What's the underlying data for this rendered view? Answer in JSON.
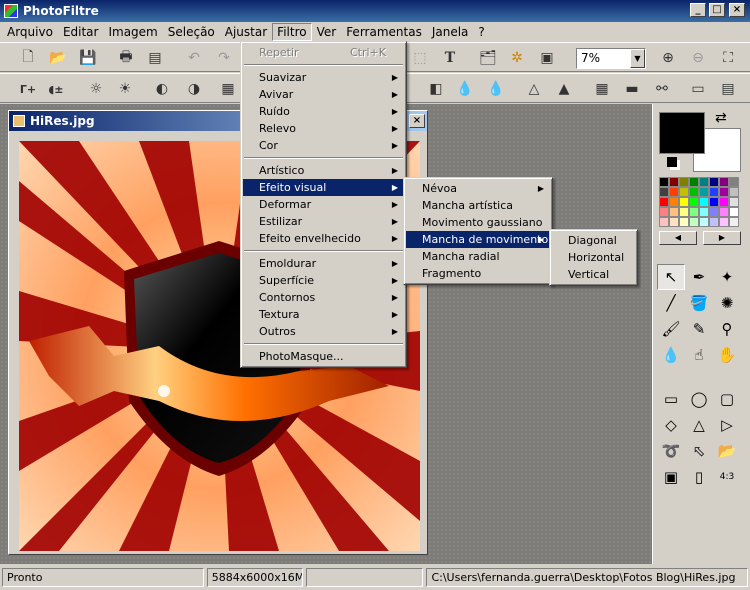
{
  "app": {
    "title": "PhotoFiltre"
  },
  "menu": [
    "Arquivo",
    "Editar",
    "Imagem",
    "Seleção",
    "Ajustar",
    "Filtro",
    "Ver",
    "Ferramentas",
    "Janela",
    "?"
  ],
  "toolbar": {
    "zoom": "7%"
  },
  "document": {
    "title": "HiRes.jpg"
  },
  "filtro_menu": {
    "repeat": {
      "label": "Repetir",
      "shortcut": "Ctrl+K"
    },
    "group1": [
      "Suavizar",
      "Avivar",
      "Ruído",
      "Relevo",
      "Cor"
    ],
    "group2": [
      "Artístico",
      "Efeito visual",
      "Deformar",
      "Estilizar",
      "Efeito envelhecido"
    ],
    "group3": [
      "Emoldurar",
      "Superfície",
      "Contornos",
      "Textura",
      "Outros"
    ],
    "photomasque": "PhotoMasque..."
  },
  "efeito_visual_menu": [
    "Névoa",
    "Mancha artística",
    "Movimento gaussiano",
    "Mancha de movimento",
    "Mancha radial",
    "Fragmento"
  ],
  "mancha_menu": [
    "Diagonal",
    "Horizontal",
    "Vertical"
  ],
  "status": {
    "state": "Pronto",
    "size": "5884x6000x16M",
    "path": "C:\\Users\\fernanda.guerra\\Desktop\\Fotos Blog\\HiRes.jpg"
  },
  "colors": {
    "accent": "#0a246a",
    "face": "#d4d0c8",
    "foreground": "#000000",
    "background": "#ffffff"
  }
}
